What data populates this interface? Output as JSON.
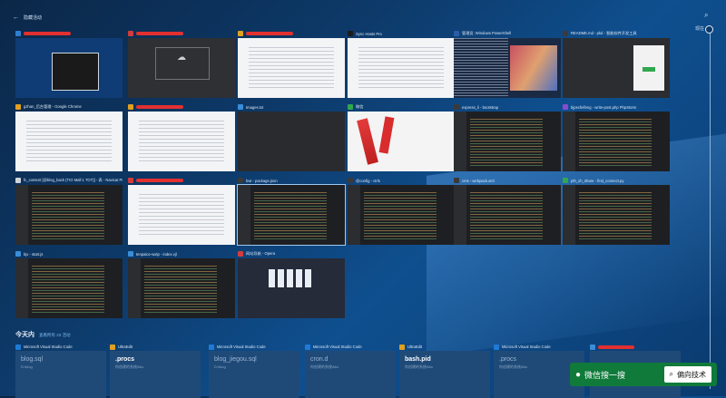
{
  "topbar": {
    "back_label": "←",
    "title": "隐藏活动"
  },
  "timeline": {
    "label": "现在"
  },
  "windows": [
    {
      "title": "",
      "icon_color": "#2d7fd2",
      "redacted": true,
      "style": "winbox"
    },
    {
      "title": "",
      "icon_color": "#d23c3c",
      "redacted": true,
      "style": "upload"
    },
    {
      "title": "",
      "icon_color": "#e0a020",
      "redacted": true,
      "style": "light"
    },
    {
      "title": "Sync Hosts Pro",
      "icon_color": "#1c1c1c",
      "redacted": false,
      "style": "light"
    },
    {
      "title": "管理员: Windows PowerShell",
      "icon_color": "#2a5ea8",
      "redacted": false,
      "style": "shell"
    },
    {
      "title": "README.md - pkd - 智能软件开发工具",
      "icon_color": "#3a3a3a",
      "redacted": false,
      "style": "greenui"
    },
    {
      "title": "gzhan_后台管理 - Google Chrome",
      "icon_color": "#e0a020",
      "redacted": false,
      "style": "light"
    },
    {
      "title": "",
      "icon_color": "#e0a020",
      "redacted": true,
      "style": "light"
    },
    {
      "title": "Images.txt",
      "icon_color": "#3a8dd8",
      "redacted": false,
      "style": "dark"
    },
    {
      "title": "微信",
      "icon_color": "#2fa84f",
      "redacted": false,
      "style": "chat"
    },
    {
      "title": "express_li - bootstrap",
      "icon_color": "#3a3a3a",
      "redacted": false,
      "style": "code"
    },
    {
      "title": "bjpecfeifeng - write-post.php PhpStorm",
      "icon_color": "#8a4ad0",
      "redacted": false,
      "style": "code"
    },
    {
      "title": "fc_content [@blog_back (TIO Mall 1 TOT)] - 表 - Navicat Pre...",
      "icon_color": "#d0d4da",
      "redacted": false,
      "style": "code"
    },
    {
      "title": "",
      "icon_color": "#d23c3c",
      "redacted": true,
      "style": "light"
    },
    {
      "title": "bwi - package.json",
      "icon_color": "#3a3a3a",
      "redacted": false,
      "style": "code"
    },
    {
      "title": "@config - ctrls",
      "icon_color": "#3a3a3a",
      "redacted": false,
      "style": "code"
    },
    {
      "title": "cms - webpack.xml",
      "icon_color": "#3a3a3a",
      "redacted": false,
      "style": "code"
    },
    {
      "title": "pth_xh_share - find_connect.py",
      "icon_color": "#2fa84f",
      "redacted": false,
      "style": "code"
    },
    {
      "title": "bjx - start.js",
      "icon_color": "#3a8dd8",
      "redacted": false,
      "style": "code"
    },
    {
      "title": "tenpaice-wxtp - index.vjl",
      "icon_color": "#3a8dd8",
      "redacted": false,
      "style": "code"
    },
    {
      "title": "网站导航 - Opera",
      "icon_color": "#d23c3c",
      "redacted": false,
      "style": "opera"
    }
  ],
  "today": {
    "title": "今天内",
    "subtitle": "查看所有 23 活动"
  },
  "files": [
    {
      "app": "Microsoft Visual Studio Code",
      "icon_color": "#1e7ad6",
      "name": "blog.sql",
      "sub": "D:\\blog",
      "highlight": false
    },
    {
      "app": "UltraEdit",
      "icon_color": "#e0a020",
      "name": ".procs",
      "sub": "你创建的系统Alla",
      "highlight": true
    },
    {
      "app": "Microsoft Visual Studio Code",
      "icon_color": "#1e7ad6",
      "name": "blog_jiegou.sql",
      "sub": "D:\\blog",
      "highlight": false
    },
    {
      "app": "Microsoft Visual Studio Code",
      "icon_color": "#1e7ad6",
      "name": "cron.d",
      "sub": "你创建的系统Alla",
      "highlight": false
    },
    {
      "app": "UltraEdit",
      "icon_color": "#e0a020",
      "name": "bash.pid",
      "sub": "你创建的系统Alla",
      "highlight": true
    },
    {
      "app": "Microsoft Visual Studio Code",
      "icon_color": "#1e7ad6",
      "name": ".procs",
      "sub": "你创建的系统Alla",
      "highlight": false
    },
    {
      "app": "",
      "icon_color": "#3a8dd8",
      "name": "",
      "sub": "",
      "highlight": false,
      "redacted": true
    }
  ],
  "wechat": {
    "label": "微信搜一搜",
    "search_text": "偏向技术"
  }
}
